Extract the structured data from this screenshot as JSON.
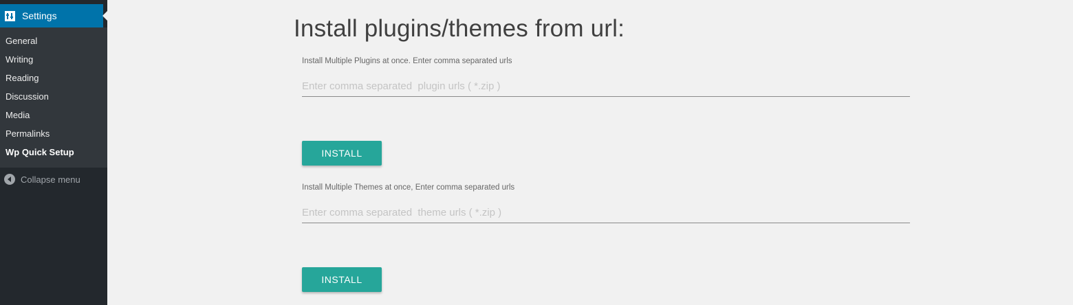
{
  "sidebar": {
    "section_title": "Settings",
    "section_icon": "settings-icon",
    "items": [
      {
        "label": "General",
        "current": false
      },
      {
        "label": "Writing",
        "current": false
      },
      {
        "label": "Reading",
        "current": false
      },
      {
        "label": "Discussion",
        "current": false
      },
      {
        "label": "Media",
        "current": false
      },
      {
        "label": "Permalinks",
        "current": false
      },
      {
        "label": "Wp Quick Setup",
        "current": true
      }
    ],
    "collapse_label": "Collapse menu",
    "collapse_icon": "collapse-arrow-icon"
  },
  "main": {
    "title": "Install plugins/themes from url:",
    "plugins": {
      "label": "Install Multiple Plugins at once. Enter comma separated urls",
      "placeholder": "Enter comma separated  plugin urls ( *.zip )",
      "value": "",
      "button_label": "INSTALL"
    },
    "themes": {
      "label": "Install Multiple Themes at once, Enter comma separated urls",
      "placeholder": "Enter comma separated  theme urls ( *.zip )",
      "value": "",
      "button_label": "INSTALL"
    }
  },
  "colors": {
    "sidebar_bg": "#23282d",
    "submenu_bg": "#32373c",
    "active_menu": "#0073aa",
    "button": "#26a69a",
    "page_bg": "#f1f1f1"
  }
}
